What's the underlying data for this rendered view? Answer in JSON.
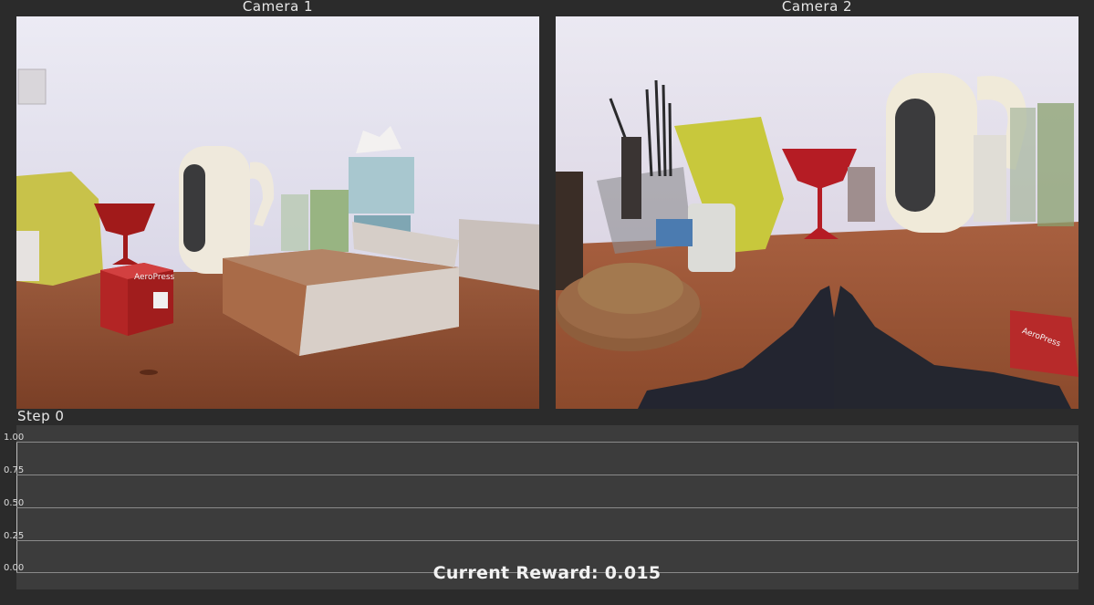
{
  "cameras": [
    {
      "title": "Camera 1",
      "box_brand": "AeroPress"
    },
    {
      "title": "Camera 2",
      "box_brand": "AeroPress"
    }
  ],
  "step": {
    "label": "Step 0"
  },
  "plot": {
    "y_ticks": [
      "1.00",
      "0.75",
      "0.50",
      "0.25",
      "0.00"
    ],
    "ylim": [
      0,
      1
    ]
  },
  "reward": {
    "text": "Current Reward: 0.015"
  },
  "colors": {
    "background": "#2b2b2b",
    "plot": "#3c3c3c",
    "gridline": "#8a8a8a"
  }
}
